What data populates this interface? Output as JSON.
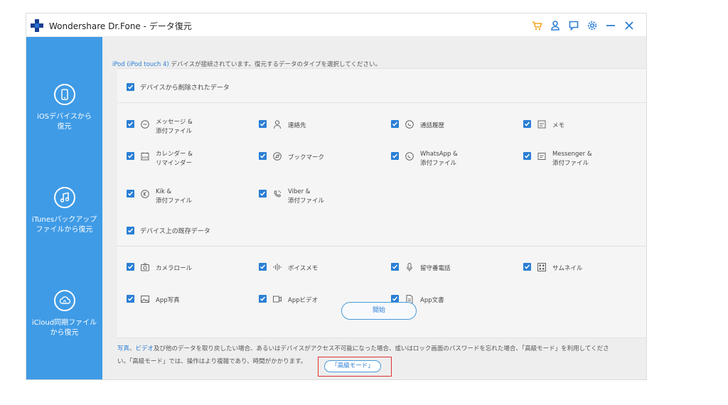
{
  "window": {
    "title": "Wondershare Dr.Fone - データ復元"
  },
  "sidebar": {
    "items": [
      {
        "label": "iOSデバイスから\n復元"
      },
      {
        "label": "iTunesバックアップ\nファイルから復元"
      },
      {
        "label": "iCloud同期ファイル\nから復元"
      }
    ]
  },
  "hint": {
    "device": "iPod (iPod touch 4)",
    "text": "デバイスが接続されています。復元するデータのタイプを選択してください。"
  },
  "deleted_section": {
    "label": "デバイスから削除されたデータ",
    "options": [
      {
        "label": "メッセージ &\n添付ファイル",
        "icon": "message-icon"
      },
      {
        "label": "連絡先",
        "icon": "contact-icon"
      },
      {
        "label": "通話履歴",
        "icon": "call-history-icon"
      },
      {
        "label": "メモ",
        "icon": "note-icon"
      },
      {
        "label": "カレンダー &\nリマインダー",
        "icon": "calendar-icon"
      },
      {
        "label": "ブックマーク",
        "icon": "bookmark-icon"
      },
      {
        "label": "WhatsApp &\n添付ファイル",
        "icon": "whatsapp-icon"
      },
      {
        "label": "Messenger &\n添付ファイル",
        "icon": "messenger-icon"
      },
      {
        "label": "Kik &\n添付ファイル",
        "icon": "kik-icon"
      },
      {
        "label": "Viber &\n添付ファイル",
        "icon": "viber-icon"
      }
    ]
  },
  "existing_section": {
    "label": "デバイス上の既存データ",
    "options": [
      {
        "label": "カメラロール",
        "icon": "camera-icon"
      },
      {
        "label": "ボイスメモ",
        "icon": "voice-memo-icon"
      },
      {
        "label": "留守番電話",
        "icon": "voicemail-icon"
      },
      {
        "label": "サムネイル",
        "icon": "thumbnail-icon"
      },
      {
        "label": "App写真",
        "icon": "app-photo-icon"
      },
      {
        "label": "Appビデオ",
        "icon": "app-video-icon"
      },
      {
        "label": "App文書",
        "icon": "app-document-icon"
      }
    ]
  },
  "start_button": {
    "label": "開始"
  },
  "footer": {
    "link1": "写真",
    "sep": "、",
    "link2": "ビデオ",
    "text1": "及び他のデータを取り戻したい場合、あるいはデバイスがアクセス不可能になった場合、或いはロック画面のパスワードを忘れた場合、「高級モード」を利用してくださ",
    "text2": "い。「高級モード」では、操作はより複雑であり、時間がかかります。",
    "advanced_button": "「高級モード」"
  },
  "colors": {
    "accent": "#2b7fd4",
    "sidebar": "#3f9be6",
    "highlight": "#e03030",
    "titlebar_icon": "#2d7fd6",
    "cart_icon": "#f5a623"
  }
}
